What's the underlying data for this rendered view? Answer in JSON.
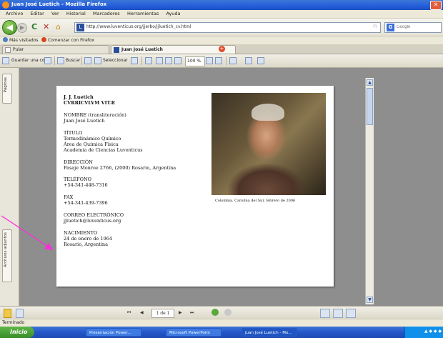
{
  "window": {
    "title": "Juan José Luetich - Mozilla Firefox",
    "close_glyph": "✕"
  },
  "menu": [
    "Archivo",
    "Editar",
    "Ver",
    "Historial",
    "Marcadores",
    "Herramientas",
    "Ayuda"
  ],
  "nav": {
    "back_glyph": "◀",
    "forward_glyph": "▶",
    "reload_glyph": "C",
    "stop_glyph": "✕",
    "home_glyph": "⌂",
    "url": "http://www.luventicus.org/jjerbo/jjluetich_cv.html",
    "search_placeholder": "Google",
    "search_logo": "G",
    "star_glyph": "☆"
  },
  "bookmarks": [
    "Más visitados",
    "Comenzar con Firefox"
  ],
  "tabs": [
    {
      "label": "Pular",
      "active": false
    },
    {
      "label": "Juan José Luetich",
      "active": true
    }
  ],
  "pdf_toolbar": {
    "save_label": "Guardar una copia",
    "search_label": "Buscar",
    "select_label": "Seleccionar",
    "zoom": "100 %",
    "new_tab_glyph": "+"
  },
  "side_tabs": [
    "Páginas",
    "Archivos adjuntos"
  ],
  "document": {
    "name": "J. J. Luetich",
    "heading": "CVRRICVLVM VITÆ",
    "sections": [
      {
        "label": "NOMBRE (transliteración)",
        "lines": [
          "Juan José Luetich"
        ]
      },
      {
        "label": "TÍTULO",
        "lines": [
          "Termodinámico Químico",
          "Área de Química Física",
          "Academia de Ciencias Luventicus"
        ]
      },
      {
        "label": "DIRECCIÓN",
        "lines": [
          "Pasaje Monroe 2766, (2000) Rosario, Argentina"
        ]
      },
      {
        "label": "TELÉFONO",
        "lines": [
          "+54-341-448-7316"
        ]
      },
      {
        "label": "FAX",
        "lines": [
          "+54-341-439-7396"
        ]
      },
      {
        "label": "CORREO ELECTRÓNICO",
        "lines": [
          "jjluetich@luventicus.org"
        ]
      },
      {
        "label": "NACIMIENTO",
        "lines": [
          "24 de enero de 1964",
          "Rosario, Argentina"
        ]
      }
    ],
    "photo_caption": "Colombia, Carolina del Sur, febrero de 2006"
  },
  "page_nav": {
    "page": "1 de 1",
    "first": "⏮",
    "prev": "◀",
    "next": "▶",
    "last": "⏭"
  },
  "status": "Terminado",
  "taskbar": {
    "start_label": "Inicio",
    "tasks": [
      "Presentación Power...",
      "Microsoft PowerPoint",
      "Juan José Luetich - Mo..."
    ],
    "clock": "▲ ◆ ◆ ◆"
  },
  "colors": {
    "pointer_arrow": "#ff2bdc",
    "titlebar": "#245edb",
    "start": "#3a8d28"
  }
}
